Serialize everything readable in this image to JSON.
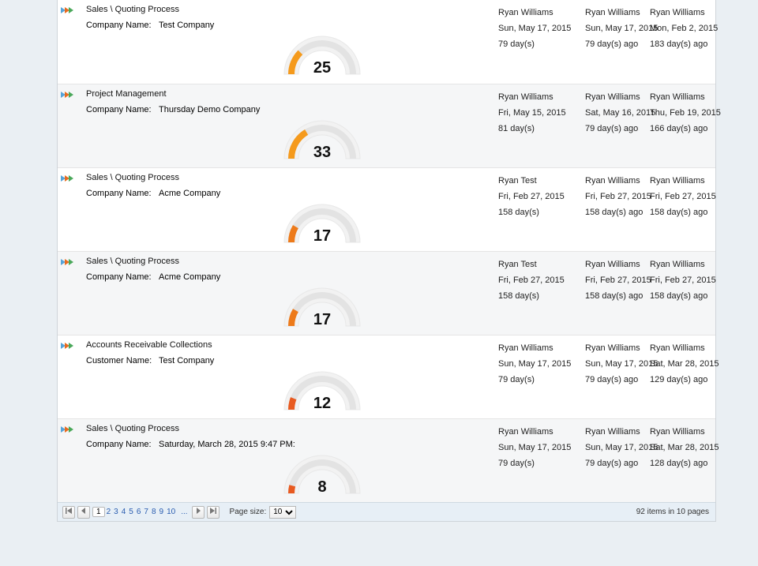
{
  "rows": [
    {
      "title": "Sales \\ Quoting Process",
      "field_label": "Company Name:",
      "field_value": "Test Company",
      "gauge": 25,
      "c1": [
        "Ryan Williams",
        "Sun, May 17, 2015",
        "79 day(s)"
      ],
      "c2": [
        "Ryan Williams",
        "Sun, May 17, 2015",
        "79 day(s) ago"
      ],
      "c3": [
        "Ryan Williams",
        "Mon, Feb 2, 2015",
        "183 day(s) ago"
      ]
    },
    {
      "title": "Project Management",
      "field_label": "Company Name:",
      "field_value": "Thursday Demo Company",
      "gauge": 33,
      "c1": [
        "Ryan Williams",
        "Fri, May 15, 2015",
        "81 day(s)"
      ],
      "c2": [
        "Ryan Williams",
        "Sat, May 16, 2015",
        "79 day(s) ago"
      ],
      "c3": [
        "Ryan Williams",
        "Thu, Feb 19, 2015",
        "166 day(s) ago"
      ]
    },
    {
      "title": "Sales \\ Quoting Process",
      "field_label": "Company Name:",
      "field_value": "Acme Company",
      "gauge": 17,
      "c1": [
        "Ryan Test",
        "Fri, Feb 27, 2015",
        "158 day(s)"
      ],
      "c2": [
        "Ryan Williams",
        "Fri, Feb 27, 2015",
        "158 day(s) ago"
      ],
      "c3": [
        "Ryan Williams",
        "Fri, Feb 27, 2015",
        "158 day(s) ago"
      ]
    },
    {
      "title": "Sales \\ Quoting Process",
      "field_label": "Company Name:",
      "field_value": "Acme Company",
      "gauge": 17,
      "c1": [
        "Ryan Test",
        "Fri, Feb 27, 2015",
        "158 day(s)"
      ],
      "c2": [
        "Ryan Williams",
        "Fri, Feb 27, 2015",
        "158 day(s) ago"
      ],
      "c3": [
        "Ryan Williams",
        "Fri, Feb 27, 2015",
        "158 day(s) ago"
      ]
    },
    {
      "title": "Accounts Receivable Collections",
      "field_label": "Customer Name:",
      "field_value": "Test Company",
      "gauge": 12,
      "c1": [
        "Ryan Williams",
        "Sun, May 17, 2015",
        "79 day(s)"
      ],
      "c2": [
        "Ryan Williams",
        "Sun, May 17, 2015",
        "79 day(s) ago"
      ],
      "c3": [
        "Ryan Williams",
        "Sat, Mar 28, 2015",
        "129 day(s) ago"
      ]
    },
    {
      "title": "Sales \\ Quoting Process",
      "field_label": "Company Name:",
      "field_value": "Saturday, March 28, 2015 9:47 PM:",
      "gauge": 8,
      "c1": [
        "Ryan Williams",
        "Sun, May 17, 2015",
        "79 day(s)"
      ],
      "c2": [
        "Ryan Williams",
        "Sun, May 17, 2015",
        "79 day(s) ago"
      ],
      "c3": [
        "Ryan Williams",
        "Sat, Mar 28, 2015",
        "128 day(s) ago"
      ]
    }
  ],
  "pager": {
    "first": "⏮",
    "prev": "◀",
    "next": "▶",
    "last": "⏭",
    "pages": [
      "1",
      "2",
      "3",
      "4",
      "5",
      "6",
      "7",
      "8",
      "9",
      "10"
    ],
    "ellipsis": "...",
    "current": "1",
    "size_label": "Page size:",
    "size_value": "10",
    "summary": "92 items in 10 pages"
  }
}
